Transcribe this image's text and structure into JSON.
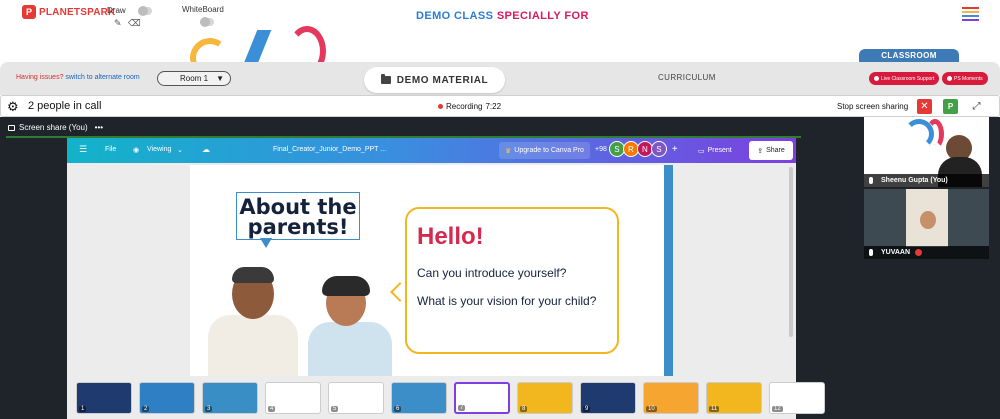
{
  "brand": {
    "name": "PLANETSPARK",
    "badge_letter": "P"
  },
  "toolbar": {
    "draw_label": "Draw",
    "whiteboard_label": "WhiteBoard"
  },
  "header": {
    "title_part1": "DEMO CLASS",
    "title_part2": "SPECIALLY FOR"
  },
  "colors": {
    "brand_red": "#e53935",
    "title_blue": "#2b7cd3",
    "title_pink": "#d81b60",
    "classroom_blue": "#3e7ab5",
    "canva_purple": "#7d3fe0"
  },
  "room": {
    "issues_text": "Having issues?",
    "alternate_link": "switch to alternate room",
    "selected_room": "Room 1",
    "demo_material_label": "DEMO MATERIAL",
    "curriculum_label": "CURRICULUM",
    "classroom_tab": "CLASSROOM",
    "live_support_label": "Live Classroom Support",
    "moments_label": "PS Moments"
  },
  "call": {
    "people_text": "2 people in call",
    "recording_label": "Recording",
    "recording_time": "7:22",
    "stop_share_label": "Stop screen sharing",
    "p_button": "P"
  },
  "screenshare": {
    "label": "Screen share (You)"
  },
  "canva": {
    "file_label": "File",
    "viewing_label": "Viewing",
    "doc_title": "Final_Creator_Junior_Demo_PPT ...",
    "upgrade_label": "Upgrade to Canva Pro",
    "extra_count": "+98",
    "avatars": [
      {
        "letter": "S",
        "color": "#43a047"
      },
      {
        "letter": "R",
        "color": "#f57c00"
      },
      {
        "letter": "N",
        "color": "#c2185b"
      },
      {
        "letter": "S",
        "color": "#7e57c2"
      }
    ],
    "present_label": "Present",
    "share_label": "Share"
  },
  "slide": {
    "heading": "About the parents!",
    "hello": "Hello!",
    "question1": "Can you introduce yourself?",
    "question2": "What is your vision for your child?"
  },
  "thumbnails": [
    {
      "num": "1",
      "color": "#1e3a6e"
    },
    {
      "num": "2",
      "color": "#2f7fc4"
    },
    {
      "num": "3",
      "color": "#3a8ec6"
    },
    {
      "num": "4",
      "color": "#ffffff"
    },
    {
      "num": "5",
      "color": "#ffffff"
    },
    {
      "num": "6",
      "color": "#3c8ec8"
    },
    {
      "num": "7",
      "color": "#ffffff"
    },
    {
      "num": "8",
      "color": "#f2b61e"
    },
    {
      "num": "9",
      "color": "#1e3a6e"
    },
    {
      "num": "10",
      "color": "#f7a531"
    },
    {
      "num": "11",
      "color": "#f2b61e"
    },
    {
      "num": "12",
      "color": "#ffffff"
    }
  ],
  "participants": [
    {
      "name": "Sheenu Gupta (You)"
    },
    {
      "name": "YUVAAN"
    }
  ]
}
